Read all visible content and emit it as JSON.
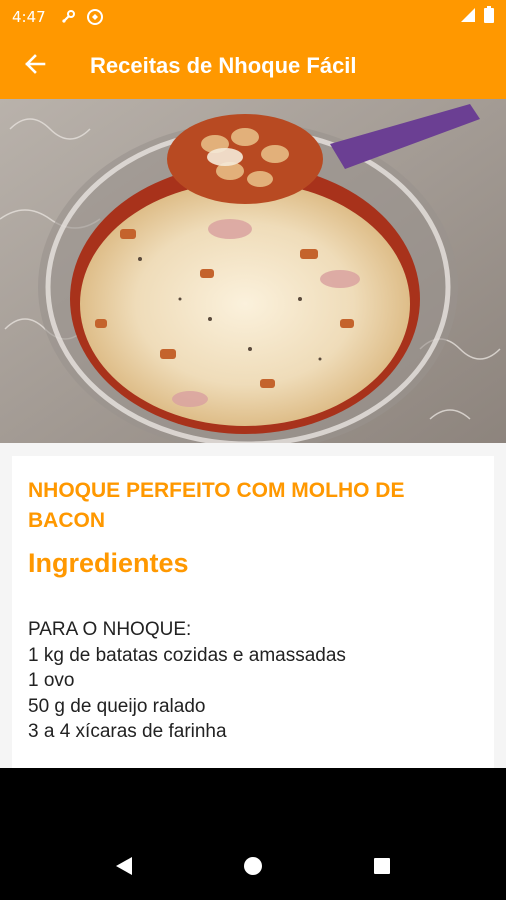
{
  "status_bar": {
    "time": "4:47",
    "icons": [
      "link-icon",
      "data-saver-icon",
      "signal-icon",
      "battery-icon"
    ]
  },
  "app_bar": {
    "title": "Receitas de Nhoque Fácil",
    "back_icon": "arrow-back-icon"
  },
  "theme": {
    "accent": "#ff9800",
    "background": "#f5f5f5",
    "text": "#222222"
  },
  "recipe": {
    "title": "NHOQUE PERFEITO COM MOLHO DE BACON",
    "ingredients_heading": "Ingredientes",
    "ingredients": [
      "PARA O NHOQUE:",
      "1 kg de batatas cozidas e amassadas",
      "1 ovo",
      "50 g de queijo ralado",
      "3 a 4 xícaras de farinha"
    ]
  },
  "nav_bar": {
    "buttons": [
      "back-triangle-icon",
      "home-circle-icon",
      "recents-square-icon"
    ]
  }
}
